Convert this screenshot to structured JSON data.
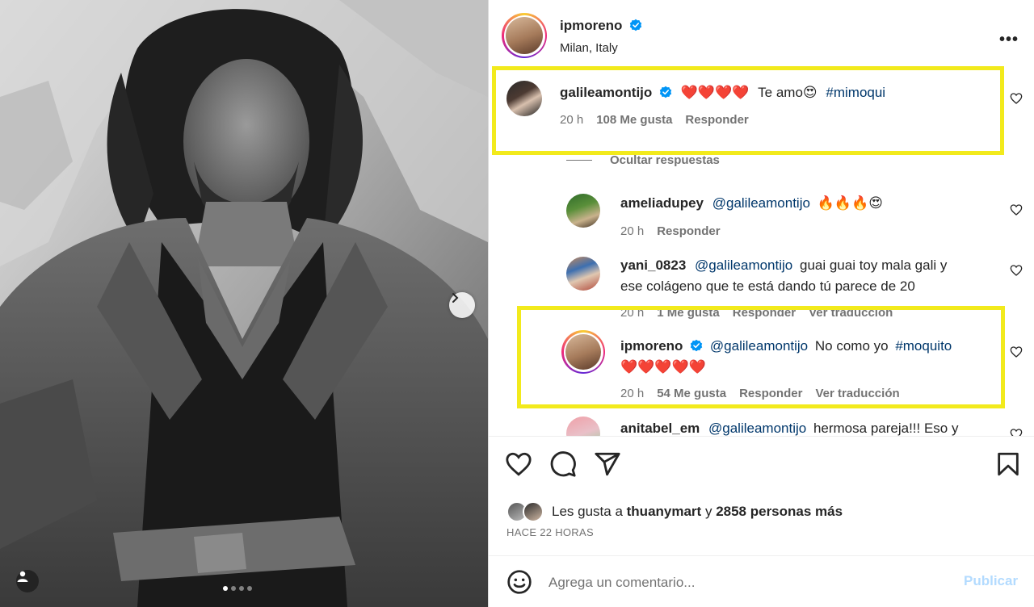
{
  "post": {
    "author": "ipmoreno",
    "location": "Milan, Italy",
    "more_label": "•••",
    "carousel": {
      "slides": 4,
      "active_index": 0
    }
  },
  "comments": [
    {
      "username": "galileamontijo",
      "verified": true,
      "text_parts": [
        "❤️❤️❤️❤️",
        "Te amo😍",
        "#mimoqui"
      ],
      "time": "20 h",
      "likes": "108 Me gusta",
      "reply_label": "Responder",
      "highlighted": true
    }
  ],
  "hide_replies_label": "Ocultar respuestas",
  "replies": [
    {
      "username": "ameliadupey",
      "mention": "@galileamontijo",
      "text": "🔥🔥🔥😍",
      "time": "20 h",
      "reply_label": "Responder"
    },
    {
      "username": "yani_0823",
      "mention": "@galileamontijo",
      "text_line1": "guai guai toy mala gali y",
      "text_line2": "ese colágeno que te está dando tú parece de 20",
      "time": "20 h",
      "likes": "1 Me gusta",
      "reply_label": "Responder",
      "translate_label": "Ver traducción"
    },
    {
      "username": "ipmoreno",
      "verified": true,
      "mention": "@galileamontijo",
      "text": "No como yo",
      "hashtag": "#moquito",
      "emoji_line": "❤️❤️❤️❤️❤️",
      "time": "20 h",
      "likes": "54 Me gusta",
      "reply_label": "Responder",
      "translate_label": "Ver traducción",
      "highlighted": true
    },
    {
      "username": "anitabel_em",
      "mention": "@galileamontijo",
      "text": "hermosa pareja!!! Eso y"
    }
  ],
  "likes_summary": {
    "prefix": "Les gusta a",
    "user": "thuanymart",
    "connector": "y",
    "others": "2858 personas más"
  },
  "timestamp": "HACE 22 HORAS",
  "composer": {
    "placeholder": "Agrega un comentario...",
    "post_label": "Publicar"
  },
  "colors": {
    "highlight": "#f2ea1c",
    "link": "#00376b",
    "verified": "#0095f6",
    "post_disabled": "#b3dbff"
  },
  "icons": [
    "heart-icon",
    "comment-icon",
    "share-icon",
    "bookmark-icon",
    "emoji-icon",
    "verified-icon",
    "chevron-right-icon",
    "user-tag-icon"
  ]
}
